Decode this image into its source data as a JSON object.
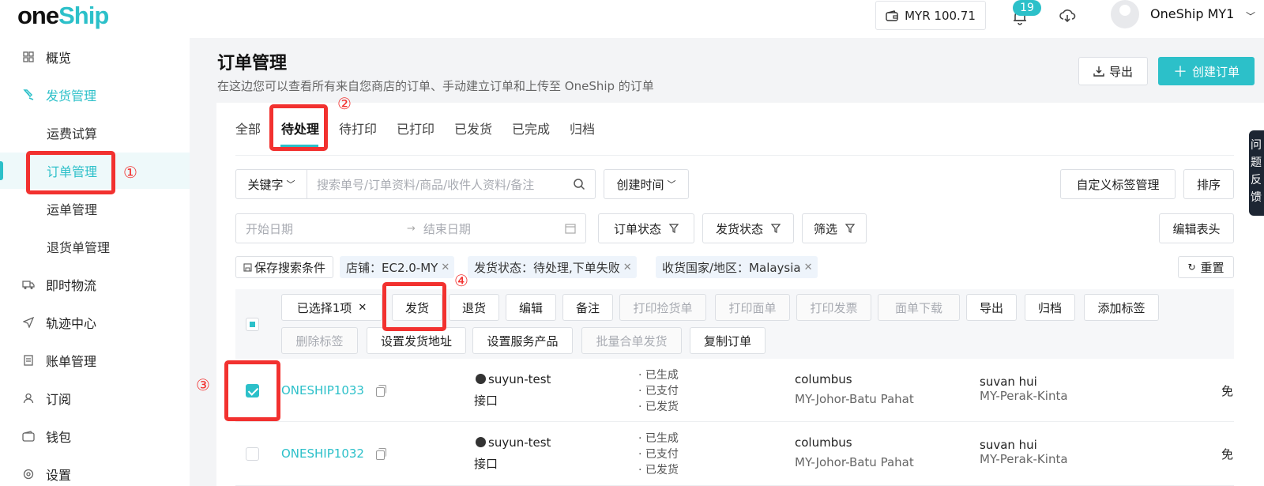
{
  "brand": {
    "logo_one": "one",
    "logo_ship": "Ship"
  },
  "header": {
    "wallet": "MYR 100.71",
    "notifications": "19",
    "user": "OneShip MY1"
  },
  "sidebar": {
    "items": [
      {
        "label": "概览",
        "icon": "grid-icon"
      },
      {
        "label": "发货管理",
        "icon": "ship-icon"
      },
      {
        "label": "运费试算"
      },
      {
        "label": "订单管理"
      },
      {
        "label": "运单管理"
      },
      {
        "label": "退货单管理"
      },
      {
        "label": "即时物流",
        "icon": "truck-icon"
      },
      {
        "label": "轨迹中心",
        "icon": "send-icon"
      },
      {
        "label": "账单管理",
        "icon": "bill-icon"
      },
      {
        "label": "订阅",
        "icon": "user-icon"
      },
      {
        "label": "钱包",
        "icon": "wallet-icon"
      },
      {
        "label": "设置",
        "icon": "settings-icon"
      }
    ]
  },
  "page": {
    "title": "订单管理",
    "desc": "在这边您可以查看所有来自您商店的订单、手动建立订单和上传至 OneShip 的订单",
    "export": "导出",
    "create": "创建订单"
  },
  "tabs": [
    "全部",
    "待处理",
    "待打印",
    "已打印",
    "已发货",
    "已完成",
    "归档"
  ],
  "filters": {
    "keyword": "关键字",
    "search_placeholder": "搜索单号/订单资料/商品/收件人资料/备注",
    "created_time": "创建时间",
    "custom_tags": "自定义标签管理",
    "sort": "排序",
    "start_date": "开始日期",
    "end_date": "结束日期",
    "order_status": "订单状态",
    "ship_status": "发货状态",
    "filter": "筛选",
    "edit_header": "编辑表头",
    "save_search": "保存搜索条件",
    "reset": "重置",
    "chips": [
      "店铺：EC2.0-MY",
      "发货状态：待处理,下单失败",
      "收货国家/地区：Malaysia"
    ]
  },
  "bulk": {
    "selected": "已选择1项",
    "actions_row1": [
      "发货",
      "退货",
      "编辑",
      "备注",
      "打印捡货单",
      "打印面单",
      "打印发票",
      "面单下载",
      "导出",
      "归档",
      "添加标签"
    ],
    "actions_row2": [
      "删除标签",
      "设置发货地址",
      "设置服务产品",
      "批量合单发货",
      "复制订单"
    ]
  },
  "orders": [
    {
      "id": "ONESHIP1033",
      "store": "suyun-test",
      "channel": "接口",
      "statuses": [
        "已生成",
        "已支付",
        "已发货"
      ],
      "sender": "columbus",
      "sender_region": "MY-Johor-Batu Pahat",
      "receiver": "suvan hui",
      "receiver_region": "MY-Perak-Kinta",
      "extra": "免",
      "checked": true
    },
    {
      "id": "ONESHIP1032",
      "store": "suyun-test",
      "channel": "接口",
      "statuses": [
        "已生成",
        "已支付",
        "已发货"
      ],
      "sender": "columbus",
      "sender_region": "MY-Johor-Batu Pahat",
      "receiver": "suvan hui",
      "receiver_region": "MY-Perak-Kinta",
      "extra": "免",
      "checked": false
    }
  ],
  "annotations": [
    "①",
    "②",
    "③",
    "④"
  ],
  "side_panel_text": "问题反馈",
  "colors": {
    "accent": "#2cc0c9",
    "annotation": "#f2312f"
  }
}
